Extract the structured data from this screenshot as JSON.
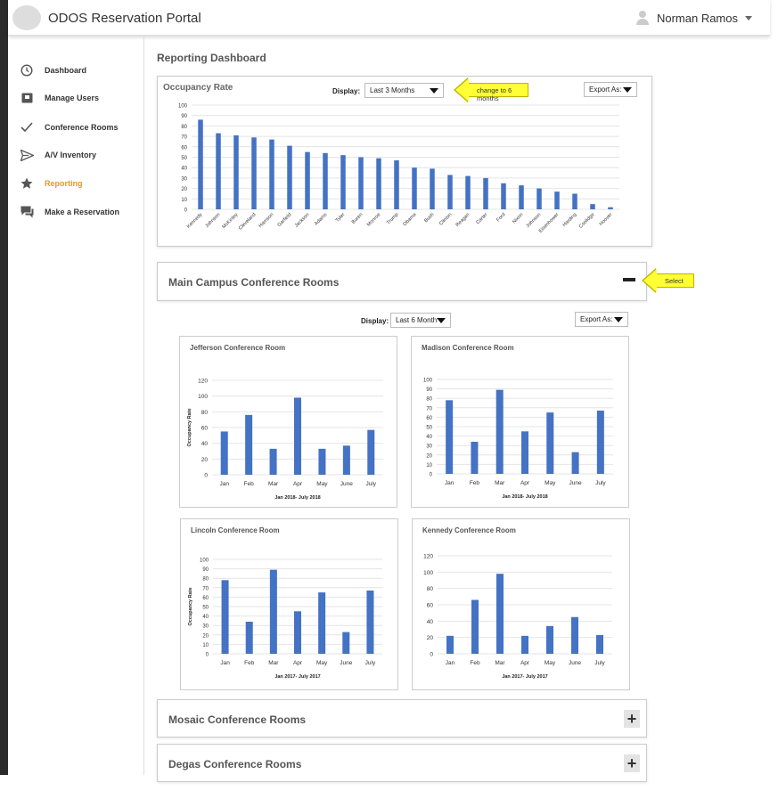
{
  "app": {
    "title": "ODOS Reservation Portal",
    "user_name": "Norman Ramos"
  },
  "sidebar": {
    "items": [
      {
        "label": "Dashboard",
        "icon": "clock-icon"
      },
      {
        "label": "Manage Users",
        "icon": "users-box-icon"
      },
      {
        "label": "Conference Rooms",
        "icon": "check-icon"
      },
      {
        "label": "A/V Inventory",
        "icon": "send-icon"
      },
      {
        "label": "Reporting",
        "icon": "star-icon",
        "active": true
      },
      {
        "label": "Make a Reservation",
        "icon": "chat-icon"
      }
    ]
  },
  "page": {
    "title": "Reporting Dashboard"
  },
  "occupancy": {
    "title": "Occupancy Rate",
    "display_label": "Display:",
    "display_value": "Last 3 Months",
    "export_label": "Export As:",
    "callout": "change to 6 months"
  },
  "main_campus": {
    "title": "Main Campus Conference Rooms",
    "callout": "Select",
    "display_label": "Display:",
    "display_value": "Last 6 Month",
    "export_label": "Export As:"
  },
  "sections": {
    "mosaic": "Mosaic Conference Rooms",
    "degas": "Degas Conference Rooms"
  },
  "chart_data": [
    {
      "type": "bar",
      "title": "Occupancy Rate",
      "categories": [
        "Kennedy",
        "Johnson",
        "McKinley",
        "Cleveland",
        "Harrison",
        "Garfield",
        "Jackson",
        "Adams",
        "Tyler",
        "Buren",
        "Monroe",
        "Trump",
        "Obama",
        "Bush",
        "Clinton",
        "Reagan",
        "Carter",
        "Ford",
        "Nixon",
        "Johnson",
        "Eisenhower",
        "Harding",
        "Coolidge",
        "Hoover"
      ],
      "values": [
        86,
        73,
        71,
        69,
        67,
        61,
        55,
        54,
        52,
        50,
        49,
        47,
        40,
        39,
        33,
        32,
        30,
        25,
        23,
        20,
        17,
        15,
        5,
        2
      ],
      "ylim": [
        0,
        100
      ],
      "yticks": [
        0,
        10,
        20,
        30,
        40,
        50,
        60,
        70,
        80,
        90,
        100
      ],
      "color": "#4472c4"
    },
    {
      "type": "bar",
      "title": "Jefferson Conference Room",
      "categories": [
        "Jan",
        "Feb",
        "Mar",
        "Apr",
        "May",
        "June",
        "July"
      ],
      "values": [
        55,
        76,
        33,
        98,
        33,
        37,
        57
      ],
      "ylim": [
        0,
        120
      ],
      "yticks": [
        0,
        20,
        40,
        60,
        80,
        100,
        120
      ],
      "ylabel": "Occupancy Rate",
      "xlabel": "Jan 2018- July 2018",
      "color": "#4472c4"
    },
    {
      "type": "bar",
      "title": "Madison Conference Room",
      "categories": [
        "Jan",
        "Feb",
        "Mar",
        "Apr",
        "May",
        "June",
        "July"
      ],
      "values": [
        78,
        34,
        89,
        45,
        65,
        23,
        67
      ],
      "ylim": [
        0,
        100
      ],
      "yticks": [
        0,
        10,
        20,
        30,
        40,
        50,
        60,
        70,
        80,
        90,
        100
      ],
      "ylabel": "",
      "xlabel": "Jan 2018- July 2018",
      "color": "#4472c4"
    },
    {
      "type": "bar",
      "title": "Lincoln Conference Room",
      "categories": [
        "Jan",
        "Feb",
        "Mar",
        "Apr",
        "May",
        "June",
        "July"
      ],
      "values": [
        78,
        34,
        89,
        45,
        65,
        23,
        67
      ],
      "ylim": [
        0,
        100
      ],
      "yticks": [
        0,
        10,
        20,
        30,
        40,
        50,
        60,
        70,
        80,
        90,
        100
      ],
      "ylabel": "Occupancy Rate",
      "xlabel": "Jan 2017- July 2017",
      "color": "#4472c4"
    },
    {
      "type": "bar",
      "title": "Kennedy Conference Room",
      "categories": [
        "Jan",
        "Feb",
        "Mar",
        "Apr",
        "May",
        "June",
        "July"
      ],
      "values": [
        22,
        66,
        98,
        22,
        34,
        45,
        23
      ],
      "ylim": [
        0,
        120
      ],
      "yticks": [
        0,
        20,
        40,
        60,
        80,
        100,
        120
      ],
      "ylabel": "",
      "xlabel": "Jan 2017- July 2017",
      "color": "#4472c4"
    }
  ]
}
